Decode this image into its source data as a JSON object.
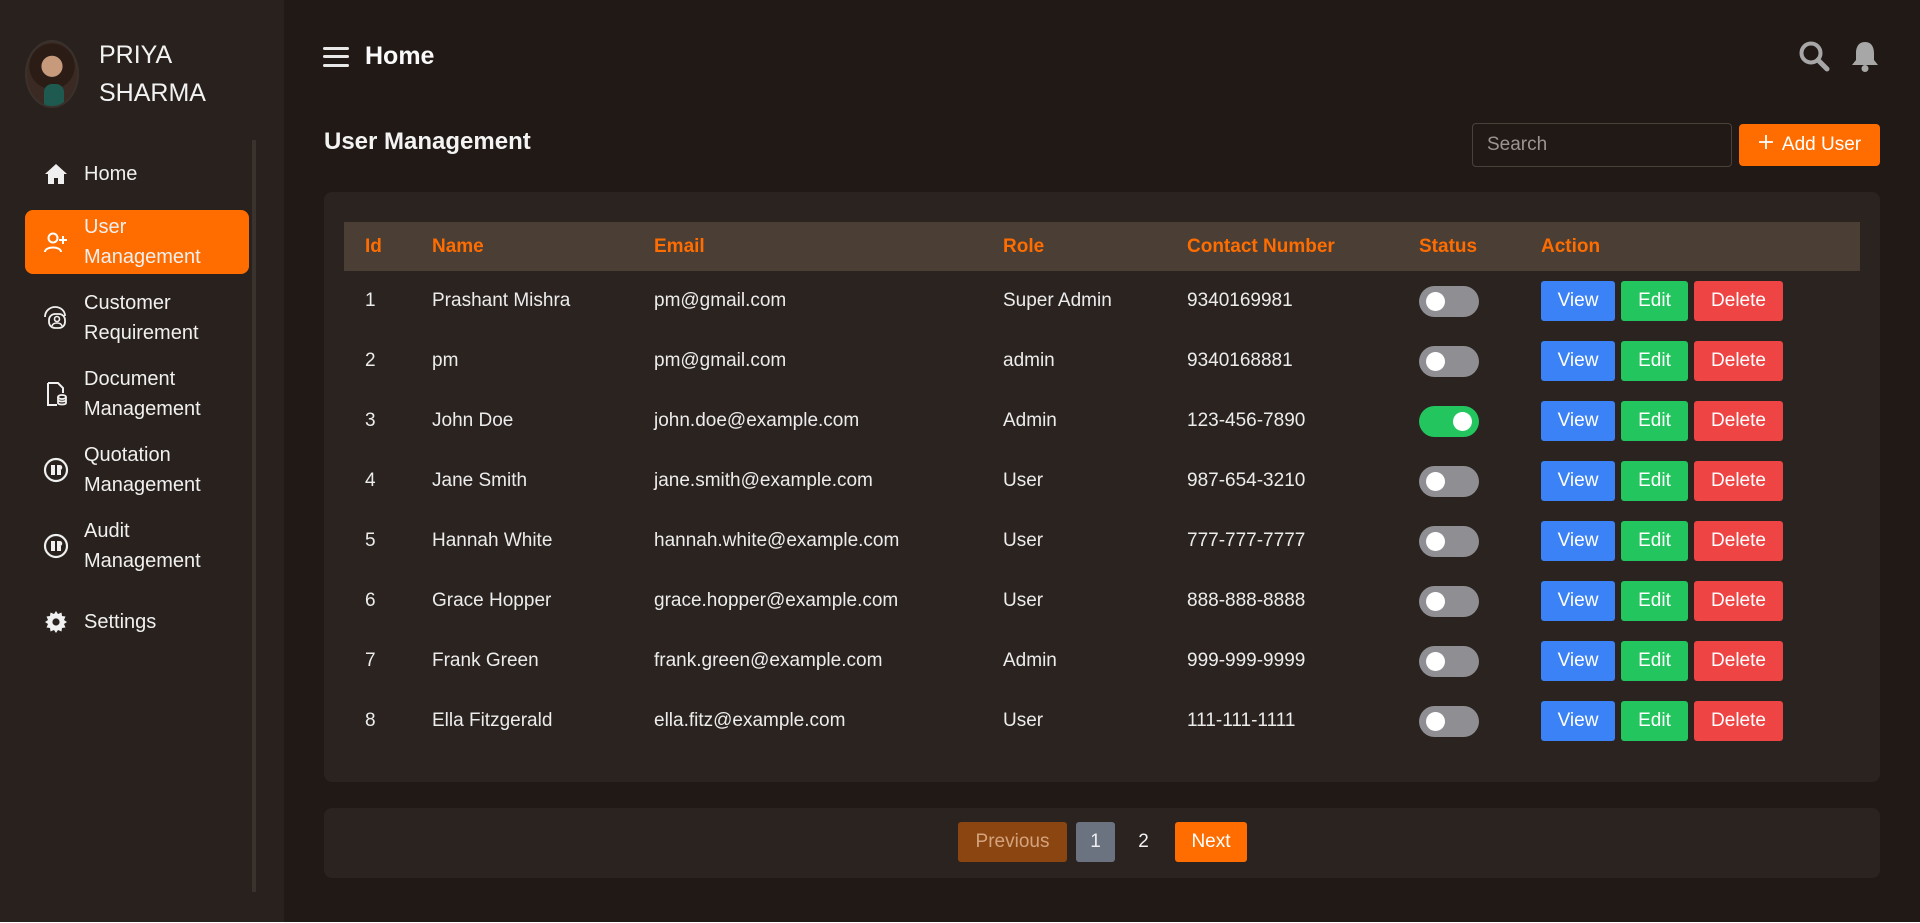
{
  "profile": {
    "name": "PRIYA SHARMA"
  },
  "sidebar": {
    "items": [
      {
        "label": "Home",
        "icon": "home-icon",
        "active": false
      },
      {
        "label": "User Management",
        "icon": "add-user-icon",
        "active": true
      },
      {
        "label": "Customer Requirement",
        "icon": "chat-users-icon",
        "active": false
      },
      {
        "label": "Document Management",
        "icon": "document-icon",
        "active": false
      },
      {
        "label": "Quotation Management",
        "icon": "quotation-icon",
        "active": false
      },
      {
        "label": "Audit Management",
        "icon": "audit-icon",
        "active": false
      },
      {
        "label": "Settings",
        "icon": "gear-icon",
        "active": false
      }
    ]
  },
  "header": {
    "title": "Home"
  },
  "main": {
    "title": "User Management",
    "search_placeholder": "Search",
    "add_user_label": "Add User"
  },
  "table": {
    "columns": [
      "Id",
      "Name",
      "Email",
      "Role",
      "Contact Number",
      "Status",
      "Action"
    ],
    "rows": [
      {
        "id": "1",
        "name": "Prashant Mishra",
        "email": "pm@gmail.com",
        "role": "Super Admin",
        "contact": "9340169981",
        "status": false
      },
      {
        "id": "2",
        "name": "pm",
        "email": "pm@gmail.com",
        "role": "admin",
        "contact": "9340168881",
        "status": false
      },
      {
        "id": "3",
        "name": "John Doe",
        "email": "john.doe@example.com",
        "role": "Admin",
        "contact": "123-456-7890",
        "status": true
      },
      {
        "id": "4",
        "name": "Jane Smith",
        "email": "jane.smith@example.com",
        "role": "User",
        "contact": "987-654-3210",
        "status": false
      },
      {
        "id": "5",
        "name": "Hannah White",
        "email": "hannah.white@example.com",
        "role": "User",
        "contact": "777-777-7777",
        "status": false
      },
      {
        "id": "6",
        "name": "Grace Hopper",
        "email": "grace.hopper@example.com",
        "role": "User",
        "contact": "888-888-8888",
        "status": false
      },
      {
        "id": "7",
        "name": "Frank Green",
        "email": "frank.green@example.com",
        "role": "Admin",
        "contact": "999-999-9999",
        "status": false
      },
      {
        "id": "8",
        "name": "Ella Fitzgerald",
        "email": "ella.fitz@example.com",
        "role": "User",
        "contact": "111-111-1111",
        "status": false
      }
    ],
    "actions": {
      "view": "View",
      "edit": "Edit",
      "delete": "Delete"
    }
  },
  "pagination": {
    "previous": "Previous",
    "pages": [
      "1",
      "2"
    ],
    "current": "1",
    "next": "Next"
  },
  "colors": {
    "accent": "#ff6d00",
    "view": "#3b82f6",
    "edit": "#22c55e",
    "delete": "#ef4444",
    "background": "#201915",
    "sidebar": "#28211d"
  }
}
